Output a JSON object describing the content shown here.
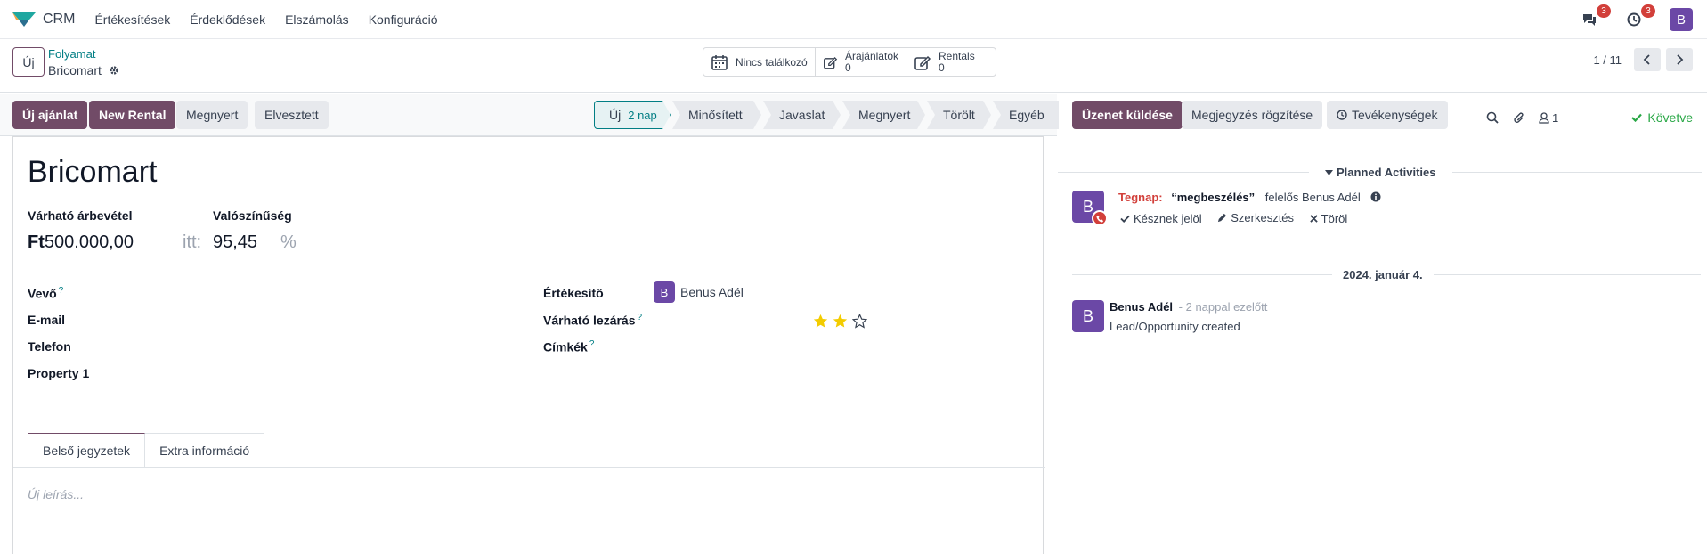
{
  "navbar": {
    "app_name": "CRM",
    "menu": [
      "Értékesítések",
      "Érdeklődések",
      "Elszámolás",
      "Konfiguráció"
    ],
    "messages_badge": "3",
    "activities_badge": "3",
    "user_initial": "B"
  },
  "control": {
    "new_label": "Új",
    "breadcrumb_parent": "Folyamat",
    "breadcrumb_current": "Bricomart",
    "smart_buttons": {
      "meetings": "Nincs találkozó",
      "quotations_label": "Árajánlatok",
      "quotations_count": "0",
      "rentals_label": "Rentals",
      "rentals_count": "0"
    },
    "pager": "1 / 11"
  },
  "statusbar": {
    "buttons": {
      "new_quote": "Új ajánlat",
      "new_rental": "New Rental",
      "won": "Megnyert",
      "lost": "Elvesztett"
    },
    "stages": [
      {
        "label": "Új",
        "sub": "2 nap",
        "active": true
      },
      {
        "label": "Minősített"
      },
      {
        "label": "Javaslat"
      },
      {
        "label": "Megnyert"
      },
      {
        "label": "Törölt"
      },
      {
        "label": "Egyéb"
      }
    ]
  },
  "form": {
    "title": "Bricomart",
    "expected_revenue_label": "Várható árbevétel",
    "probability_label": "Valószínűség",
    "currency": "Ft",
    "expected_revenue": "500.000,00",
    "at_label": "itt:",
    "probability": "95,45",
    "percent": "%",
    "customer_label": "Vevő",
    "email_label": "E-mail",
    "phone_label": "Telefon",
    "property_label": "Property 1",
    "salesperson_label": "Értékesítő",
    "salesperson_initial": "B",
    "salesperson_name": "Benus Adél",
    "expected_closing_label": "Várható lezárás",
    "tags_label": "Címkék",
    "priority_stars": 2,
    "priority_max": 3,
    "help_mark": "?",
    "tabs": [
      "Belső jegyzetek",
      "Extra információ"
    ],
    "notes_placeholder": "Új leírás..."
  },
  "chatter": {
    "send_message": "Üzenet küldése",
    "log_note": "Megjegyzés rögzítése",
    "activities": "Tevékenységek",
    "followers_count": "1",
    "following": "Követve",
    "planned_activities_title": "Planned Activities",
    "activity": {
      "avatar_initial": "B",
      "when": "Tegnap:",
      "summary": "“megbeszélés”",
      "responsible": "felelős Benus Adél",
      "mark_done": "Késznek jelöl",
      "edit": "Szerkesztés",
      "cancel": "Töröl"
    },
    "date_separator": "2024. január 4.",
    "message": {
      "avatar_initial": "B",
      "author": "Benus Adél",
      "time": "- 2 nappal ezelőtt",
      "body": "Lead/Opportunity created"
    }
  },
  "colors": {
    "brand": "#714b67",
    "accent": "#017e84",
    "avatar": "#6b48a6",
    "danger": "#d23f3a",
    "success": "#28a745",
    "star": "#f3cc00"
  }
}
